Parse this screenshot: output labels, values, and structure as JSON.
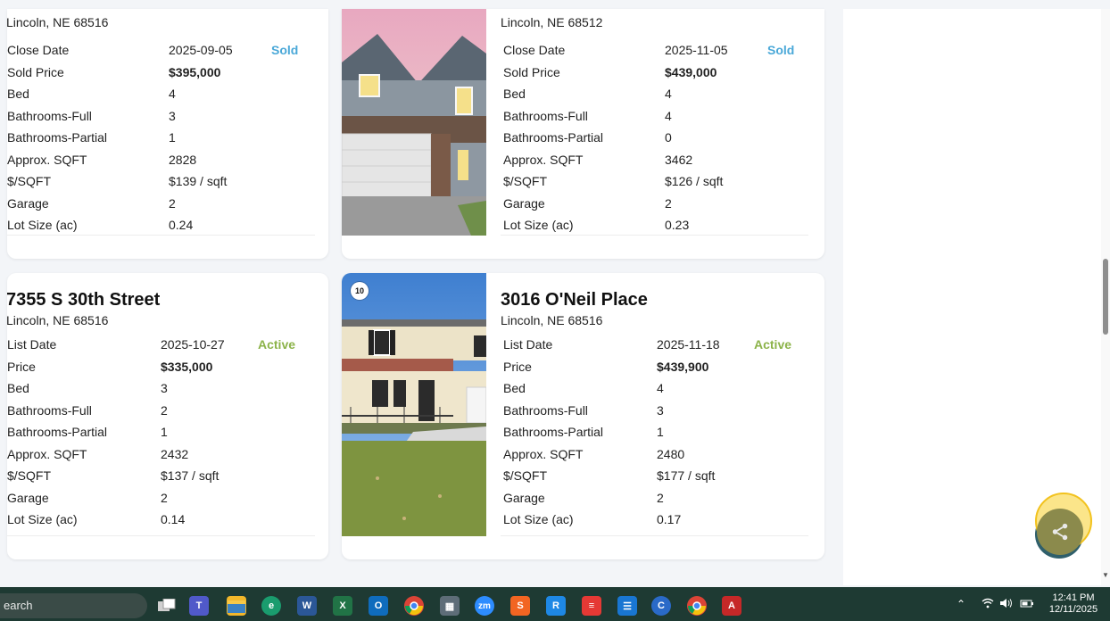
{
  "listings": [
    {
      "city": "Lincoln, NE 68516",
      "date_label": "Close Date",
      "date": "2025-09-05",
      "status": "Sold",
      "price_label": "Sold Price",
      "price": "$395,000",
      "bed": "4",
      "bath_full": "3",
      "bath_partial": "1",
      "sqft": "2828",
      "per_sqft": "$139 / sqft",
      "garage": "2",
      "lot": "0.24"
    },
    {
      "city": "Lincoln, NE 68512",
      "date_label": "Close Date",
      "date": "2025-11-05",
      "status": "Sold",
      "price_label": "Sold Price",
      "price": "$439,000",
      "bed": "4",
      "bath_full": "4",
      "bath_partial": "0",
      "sqft": "3462",
      "per_sqft": "$126 / sqft",
      "garage": "2",
      "lot": "0.23"
    },
    {
      "address": "7355 S 30th Street",
      "city": "Lincoln, NE 68516",
      "date_label": "List Date",
      "date": "2025-10-27",
      "status": "Active",
      "price_label": "Price",
      "price": "$335,000",
      "bed": "3",
      "bath_full": "2",
      "bath_partial": "1",
      "sqft": "2432",
      "per_sqft": "$137 / sqft",
      "garage": "2",
      "lot": "0.14"
    },
    {
      "address": "3016 O'Neil Place",
      "city": "Lincoln, NE 68516",
      "photo_count": "10",
      "date_label": "List Date",
      "date": "2025-11-18",
      "status": "Active",
      "price_label": "Price",
      "price": "$439,900",
      "bed": "4",
      "bath_full": "3",
      "bath_partial": "1",
      "sqft": "2480",
      "per_sqft": "$177 / sqft",
      "garage": "2",
      "lot": "0.17"
    }
  ],
  "labels": {
    "bed": "Bed",
    "bath_full": "Bathrooms-Full",
    "bath_partial": "Bathrooms-Partial",
    "sqft": "Approx. SQFT",
    "per_sqft": "$/SQFT",
    "garage": "Garage",
    "lot": "Lot Size (ac)"
  },
  "colors": {
    "sold": "#4aa8d8",
    "active": "#8cb34a",
    "taskbar": "#1e3a33"
  },
  "taskbar": {
    "search_text": "earch",
    "zoom_app_label": "zm",
    "time": "12:41 PM",
    "date": "12/11/2025"
  }
}
